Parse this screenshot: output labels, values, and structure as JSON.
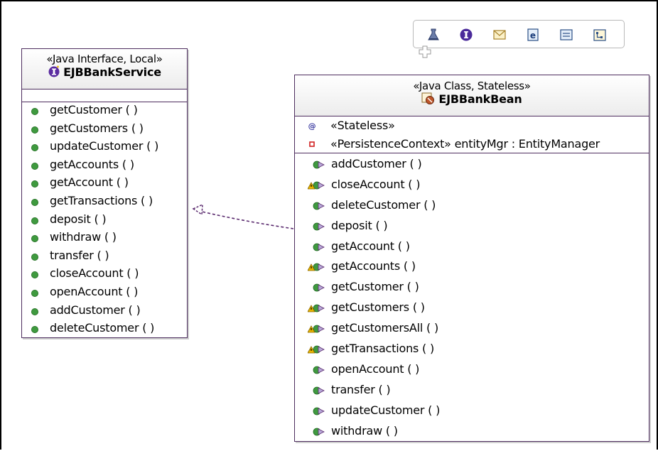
{
  "interface": {
    "stereotype": "«Java Interface, Local»",
    "name": "EJBBankService",
    "operations": [
      "getCustomer ( )",
      "getCustomers ( )",
      "updateCustomer ( )",
      "getAccounts ( )",
      "getAccount ( )",
      "getTransactions ( )",
      "deposit ( )",
      "withdraw ( )",
      "transfer ( )",
      "closeAccount ( )",
      "openAccount ( )",
      "addCustomer ( )",
      "deleteCustomer ( )"
    ]
  },
  "bean": {
    "stereotype": "«Java Class, Stateless»",
    "name": "EJBBankBean",
    "annotations": [
      {
        "text": "«Stateless»",
        "icon": "annotation-icon"
      },
      {
        "text": "«PersistenceContext» entityMgr : EntityManager",
        "icon": "private-field-icon"
      }
    ],
    "operations": [
      {
        "text": "addCustomer ( )",
        "warning": false
      },
      {
        "text": "closeAccount ( )",
        "warning": true
      },
      {
        "text": "deleteCustomer ( )",
        "warning": false
      },
      {
        "text": "deposit ( )",
        "warning": false
      },
      {
        "text": "getAccount ( )",
        "warning": false
      },
      {
        "text": "getAccounts ( )",
        "warning": true
      },
      {
        "text": "getCustomer ( )",
        "warning": false
      },
      {
        "text": "getCustomers ( )",
        "warning": true
      },
      {
        "text": "getCustomersAll ( )",
        "warning": true
      },
      {
        "text": "getTransactions ( )",
        "warning": true
      },
      {
        "text": "openAccount ( )",
        "warning": false
      },
      {
        "text": "transfer ( )",
        "warning": false
      },
      {
        "text": "updateCustomer ( )",
        "warning": false
      },
      {
        "text": "withdraw ( )",
        "warning": false
      }
    ]
  },
  "palette": {
    "tools": [
      "flask-icon",
      "info-icon",
      "envelope-icon",
      "e-icon",
      "note-icon",
      "hierarchy-icon"
    ]
  },
  "colors": {
    "box_border": "#4d2d5e",
    "public_method": "#3f9a3f",
    "interface_icon": "#5a2ca0",
    "warning": "#e8b400",
    "dependency_line": "#5a2a6e"
  }
}
